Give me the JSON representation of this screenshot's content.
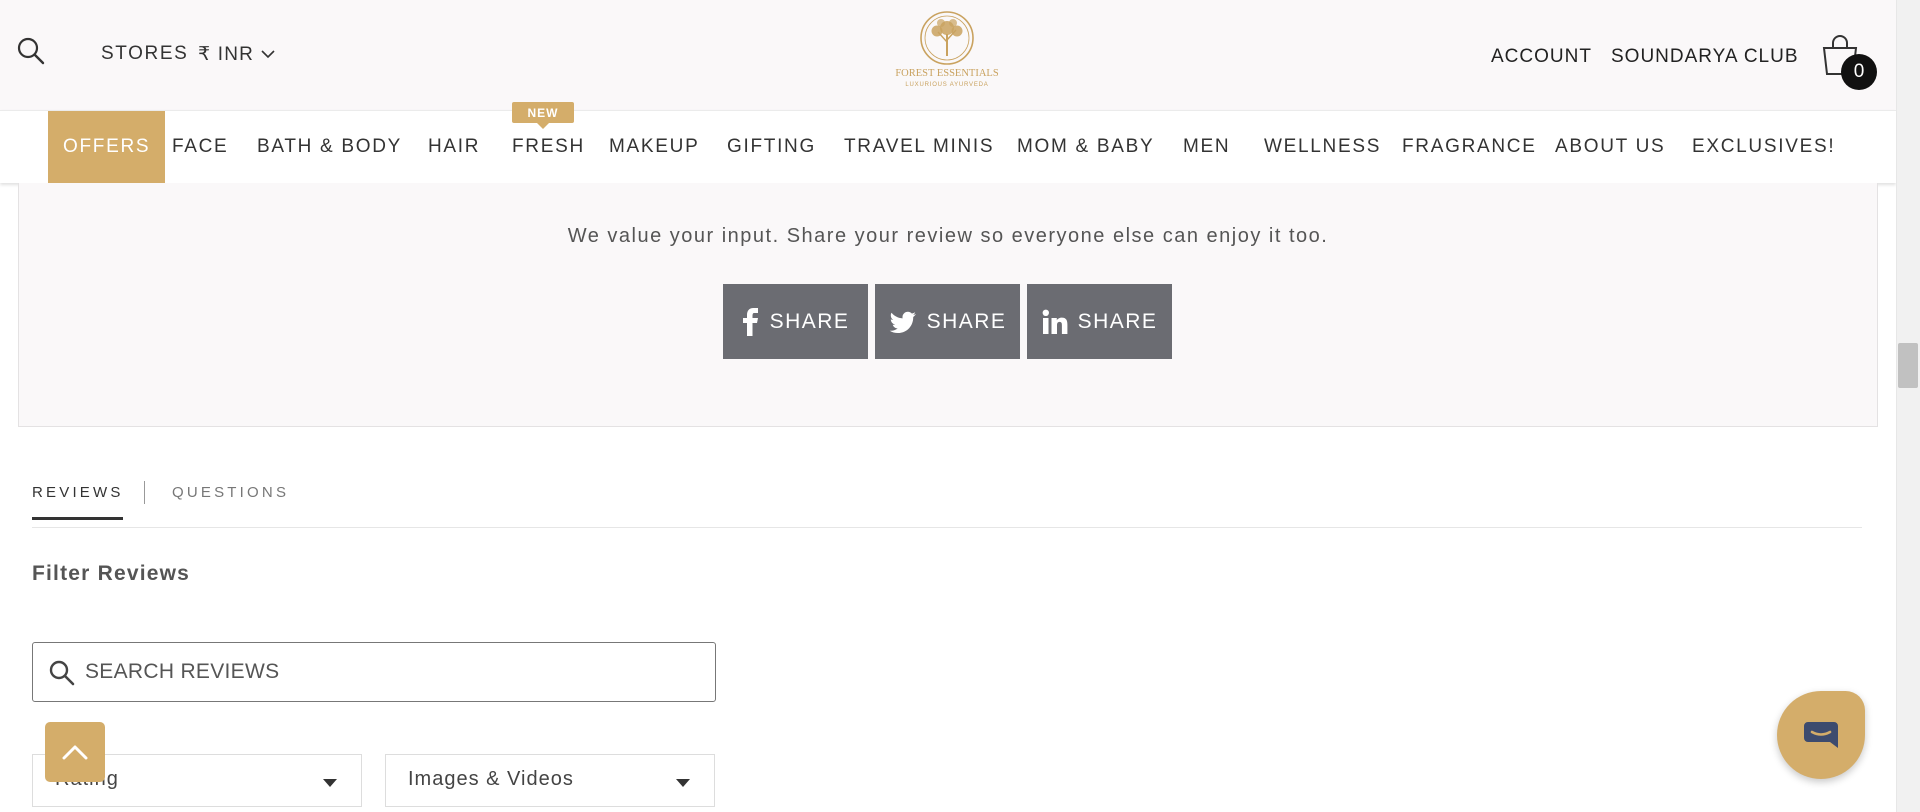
{
  "header": {
    "stores_label": "STORES",
    "currency_label": "₹ INR",
    "logo_name": "FOREST ESSENTIALS",
    "logo_tagline": "LUXURIOUS AYURVEDA",
    "account_label": "ACCOUNT",
    "club_label": "SOUNDARYA CLUB",
    "cart_count": "0"
  },
  "nav": {
    "items": [
      {
        "label": "OFFERS"
      },
      {
        "label": "FACE"
      },
      {
        "label": "BATH & BODY"
      },
      {
        "label": "HAIR"
      },
      {
        "label": "FRESH"
      },
      {
        "label": "MAKEUP"
      },
      {
        "label": "GIFTING"
      },
      {
        "label": "TRAVEL MINIS"
      },
      {
        "label": "MOM & BABY"
      },
      {
        "label": "MEN"
      },
      {
        "label": "WELLNESS"
      },
      {
        "label": "FRAGRANCE"
      },
      {
        "label": "ABOUT US"
      },
      {
        "label": "EXCLUSIVES!"
      }
    ],
    "new_badge": "NEW"
  },
  "review_prompt": {
    "text": "We value your input. Share your review so everyone else can enjoy it too.",
    "share_buttons": [
      {
        "icon": "facebook-icon",
        "label": "SHARE"
      },
      {
        "icon": "twitter-icon",
        "label": "SHARE"
      },
      {
        "icon": "linkedin-icon",
        "label": "SHARE"
      }
    ]
  },
  "tabs": [
    {
      "label": "REVIEWS",
      "active": true
    },
    {
      "label": "QUESTIONS",
      "active": false
    }
  ],
  "filter": {
    "title": "Filter Reviews",
    "search_placeholder": "SEARCH REVIEWS",
    "rating_label": "Rating",
    "media_label": "Images & Videos"
  },
  "colors": {
    "accent": "#d4ad6a",
    "share_button": "#6b6c72",
    "panel_bg": "#faf8f9"
  }
}
